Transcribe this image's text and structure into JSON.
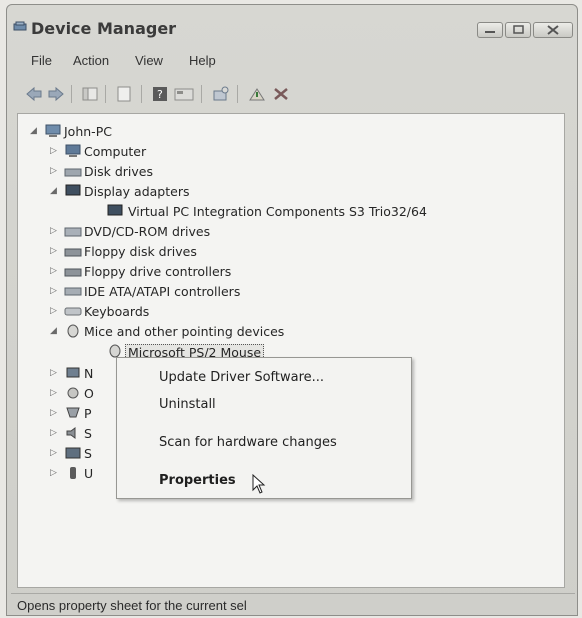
{
  "window": {
    "title": "Device Manager",
    "controls": [
      "minimize",
      "maximize",
      "close"
    ]
  },
  "menu": {
    "items": [
      "File",
      "Action",
      "View",
      "Help"
    ]
  },
  "toolbar": {
    "icons": [
      "back-arrow-icon",
      "forward-arrow-icon",
      "show-hide-console-tree-icon",
      "properties-pane-icon",
      "help-icon",
      "device-properties-icon",
      "scan-hardware-icon",
      "update-driver-icon",
      "uninstall-icon"
    ]
  },
  "tree": {
    "root": "John-PC",
    "categories": [
      {
        "label": "Computer",
        "expanded": false
      },
      {
        "label": "Disk drives",
        "expanded": false
      },
      {
        "label": "Display adapters",
        "expanded": true,
        "children": [
          "Virtual PC Integration Components S3 Trio32/64"
        ]
      },
      {
        "label": "DVD/CD-ROM drives",
        "expanded": false
      },
      {
        "label": "Floppy disk drives",
        "expanded": false
      },
      {
        "label": "Floppy drive controllers",
        "expanded": false
      },
      {
        "label": "IDE ATA/ATAPI controllers",
        "expanded": false
      },
      {
        "label": "Keyboards",
        "expanded": false
      },
      {
        "label": "Mice and other pointing devices",
        "expanded": true,
        "children": [
          "Microsoft PS/2 Mouse"
        ]
      },
      {
        "label": "N",
        "expanded": false
      },
      {
        "label": "O",
        "expanded": false
      },
      {
        "label": "P",
        "expanded": false
      },
      {
        "label": "S",
        "expanded": false
      },
      {
        "label": "S",
        "expanded": false
      },
      {
        "label": "U",
        "expanded": false
      }
    ]
  },
  "context_menu": {
    "items": [
      "Update Driver Software...",
      "Uninstall",
      "Scan for hardware changes",
      "Properties"
    ]
  },
  "status": {
    "text": "Opens property sheet for the current sel"
  }
}
